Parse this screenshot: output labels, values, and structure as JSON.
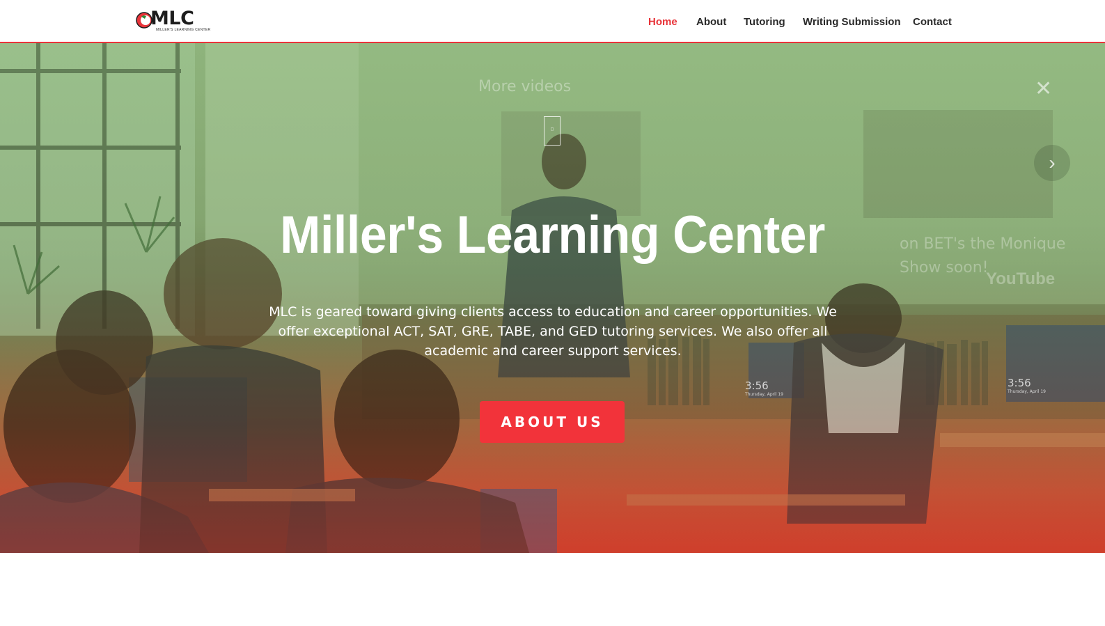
{
  "header": {
    "logo_text": "MLC",
    "logo_subtitle": "MILLER'S LEARNING CENTER",
    "nav": [
      {
        "label": "Home",
        "active": true
      },
      {
        "label": "About",
        "active": false
      },
      {
        "label": "Tutoring",
        "active": false
      },
      {
        "label": "Writing Submission",
        "active": false
      },
      {
        "label": "Contact",
        "active": false
      }
    ]
  },
  "hero": {
    "title": "Miller's Learning Center",
    "description": "MLC is geared toward giving clients access to education and career opportunities. We offer exceptional ACT, SAT, GRE, TABE, and GED tutoring services. We also offer all academic and career support services.",
    "cta_label": "ABOUT US",
    "video": {
      "more_videos": "More videos",
      "caption_line1": "on BET's the Monique",
      "caption_line2": "Show soon!",
      "brand": "YouTube"
    },
    "clocks": [
      {
        "time": "3:56",
        "date": "Thursday, April 19"
      },
      {
        "time": "3:56",
        "date": "Thursday, April 19"
      }
    ]
  },
  "colors": {
    "accent": "#e8343a",
    "button": "#f2333a",
    "nav_text": "#2a2a2a"
  }
}
